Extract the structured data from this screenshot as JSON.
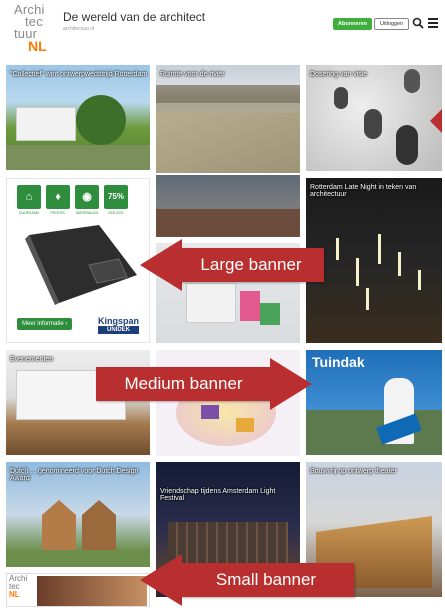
{
  "header": {
    "logo": {
      "line1": "Archi",
      "line2": "tec",
      "line3": "tuur",
      "line4": "NL"
    },
    "title": "De wereld van de architect",
    "subtitle": "architectuur.nl",
    "subscribe_label": "Abonneren",
    "logout_label": "Uitloggen",
    "search_icon": "search-icon",
    "menu_icon": "menu-icon"
  },
  "tiles": {
    "t1": "\"Collectief\" wint ontwerpwedstrijd Rotterdam",
    "t2": "Ruimte voor de rivier",
    "t3": "Dosering van visie",
    "t5": "Rotterdam Late Night in teken van architectuur",
    "t7": "Tuindak",
    "t8": "Evenementen",
    "t10": "Dutch ... genomineerd voor Dutch Design Award",
    "t11": "Vriendschap tijdens Amsterdam Light Festival",
    "t12": "Bouwvrij op ontwerp theater"
  },
  "ad_large": {
    "badges": [
      "⌂",
      "♦",
      "◉",
      "75%"
    ],
    "badge_labels": [
      "DUURZAAM",
      "PROFIEL",
      "MATERIALEN",
      "ISOLATIE"
    ],
    "button_label": "Meer informatie ›",
    "brand": "Kingspan",
    "brand_sub": "UNIDEK"
  },
  "banners": {
    "large": "Large banner",
    "medium": "Medium banner",
    "small": "Small banner"
  },
  "colors": {
    "banner_red": "#b92f2f",
    "green": "#3fae3f",
    "logo_orange": "#ff7a00"
  }
}
